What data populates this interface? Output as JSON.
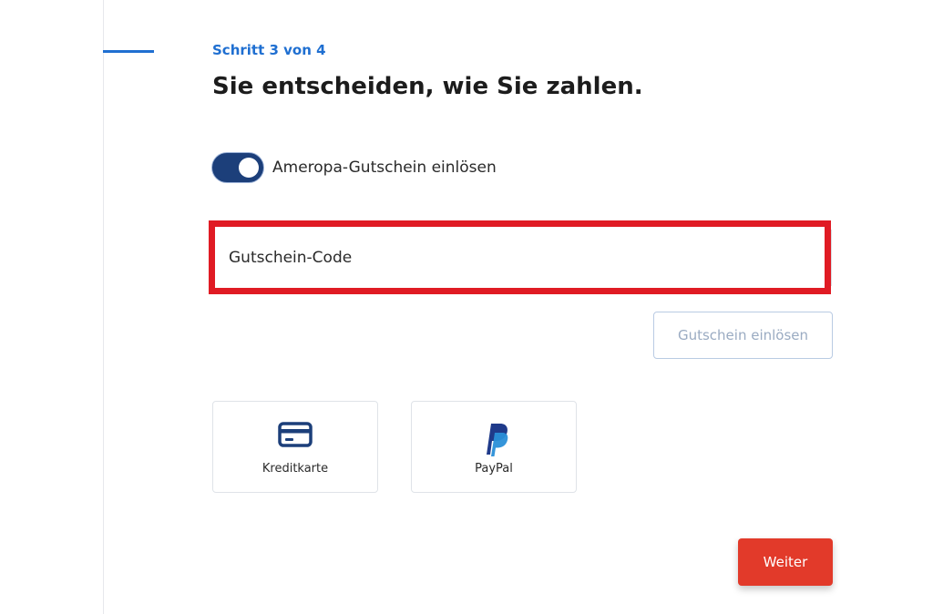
{
  "progress": {
    "step_label": "Schritt 3 von 4",
    "current_step": 3,
    "total_steps": 4,
    "accent_color": "#1f6fd1"
  },
  "heading": "Sie entscheiden, wie Sie zahlen.",
  "voucher": {
    "toggle_label": "Ameropa-Gutschein einlösen",
    "toggle_on": true,
    "code_placeholder": "Gutschein-Code",
    "code_value": "",
    "highlight_color": "#e01b24",
    "redeem_label": "Gutschein einlösen",
    "redeem_disabled": true
  },
  "payment_methods": [
    {
      "label": "Kreditkarte",
      "icon": "credit-card-icon",
      "color": "#1c3f7a"
    },
    {
      "label": "PayPal",
      "icon": "paypal-icon",
      "color": "#1f3a8a"
    }
  ],
  "next_button": {
    "label": "Weiter",
    "color": "#e23a2a"
  }
}
